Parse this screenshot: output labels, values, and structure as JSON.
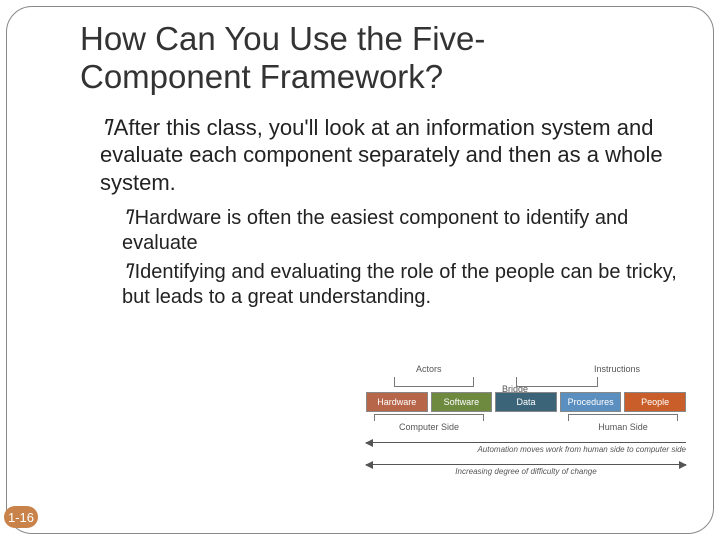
{
  "title": "How Can You Use the Five-Component Framework?",
  "bullets": {
    "main": "After this class, you'll look at an information system and evaluate each component separately and then as a whole system.",
    "sub1": "Hardware is often the easiest component to identify and evaluate",
    "sub2": "Identifying and evaluating the role of the people can be tricky, but leads to a great understanding."
  },
  "page": "1-16",
  "diagram": {
    "top": {
      "actors": "Actors",
      "instructions": "Instructions",
      "bridge": "Bridge"
    },
    "boxes": [
      "Hardware",
      "Software",
      "Data",
      "Procedures",
      "People"
    ],
    "under": {
      "left": "Computer Side",
      "right": "Human Side"
    },
    "arrow1": "Automation moves work from human side to computer side",
    "arrow2": "Increasing degree of difficulty of change"
  }
}
